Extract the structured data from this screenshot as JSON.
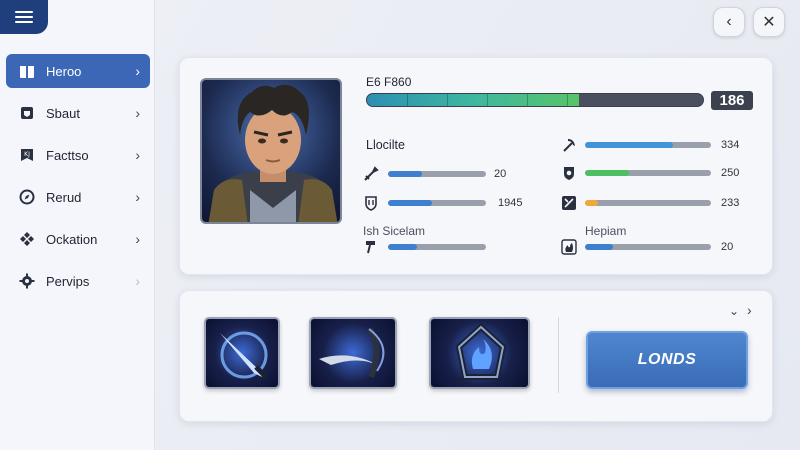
{
  "nav": {
    "items": [
      {
        "label": "Heroo",
        "active": true,
        "icon": "gift-box-icon"
      },
      {
        "label": "Sbaut",
        "active": false,
        "icon": "scroll-icon"
      },
      {
        "label": "Facttso",
        "active": false,
        "icon": "banner-icon"
      },
      {
        "label": "Rerud",
        "active": false,
        "icon": "compass-icon"
      },
      {
        "label": "Ockation",
        "active": false,
        "icon": "diamond-cluster-icon"
      },
      {
        "label": "Pervips",
        "active": false,
        "icon": "gear-icon"
      }
    ]
  },
  "header": {
    "back_icon": "chevron-left-icon",
    "close_icon": "close-icon"
  },
  "hero": {
    "level_label": "E6 F860",
    "xp_fraction": 0.63,
    "xp_value": "186",
    "left_section_title": "Llocilte",
    "left_section_subtitle": "Ish  Sicelam",
    "right_section_subtitle": "Hepiam",
    "left_stats": [
      {
        "icon": "sword-icon",
        "value": "20",
        "fill": 0.35,
        "color": "#3f7fd0"
      },
      {
        "icon": "shield-icon",
        "value": "1945",
        "fill": 0.45,
        "color": "#3f7fd0"
      },
      {
        "icon": "hammer-icon",
        "value": "",
        "fill": 0.3,
        "color": "#3f7fd0"
      }
    ],
    "right_stats": [
      {
        "icon": "pickaxe-icon",
        "value": "334",
        "fill": 0.7,
        "color": "#3f95d8"
      },
      {
        "icon": "heart-shield-icon",
        "value": "250",
        "fill": 0.35,
        "color": "#4cbf62"
      },
      {
        "icon": "cross-swords-icon",
        "value": "233",
        "fill": 0.1,
        "color": "#f2a838"
      },
      {
        "icon": "flame-icon",
        "value": "20",
        "fill": 0.22,
        "color": "#3f7fd0"
      }
    ]
  },
  "abilities": {
    "items": [
      {
        "name": "blade-slash-ability"
      },
      {
        "name": "scythe-strike-ability"
      },
      {
        "name": "shadow-flame-ability"
      }
    ],
    "primary_button": "LONDS"
  },
  "colors": {
    "accent": "#3b67b6",
    "sidebar_header": "#1e3f7c"
  }
}
